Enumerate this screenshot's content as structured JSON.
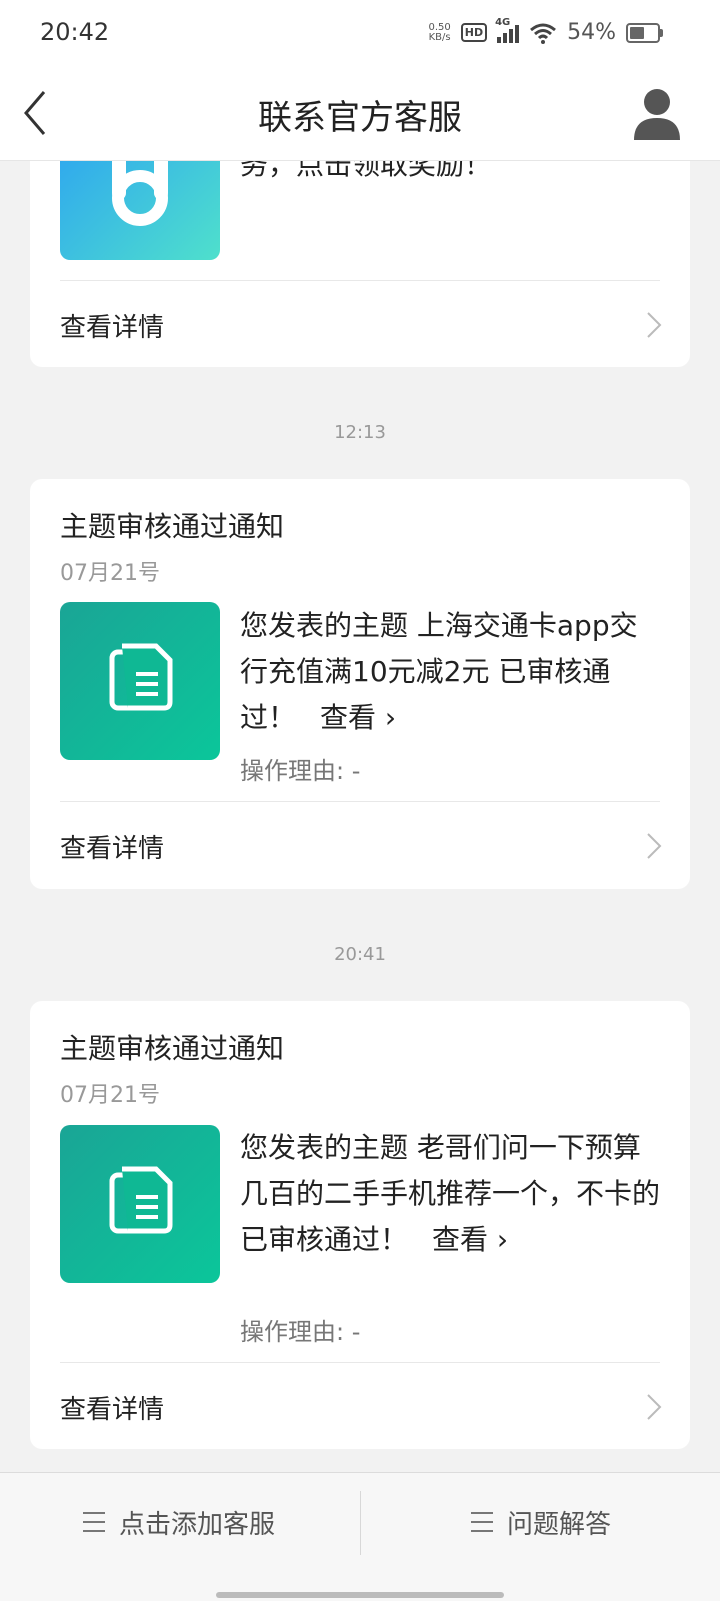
{
  "status": {
    "time": "20:42",
    "net_speed_value": "0.50",
    "net_speed_unit": "KB/s",
    "hd": "HD",
    "network": "4G",
    "battery": "54%",
    "battery_level": 0.54
  },
  "header": {
    "title": "联系官方客服"
  },
  "cards": [
    {
      "message_tail": "务，点击领取奖励！",
      "detail_label": "查看详情"
    },
    {
      "timestamp": "12:13",
      "title": "主题审核通过通知",
      "date": "07月21号",
      "message": "您发表的主题 上海交通卡app交行充值满10元减2元 已审核通过！",
      "view": "查看 ›",
      "reason": "操作理由: -",
      "detail_label": "查看详情"
    },
    {
      "timestamp": "20:41",
      "title": "主题审核通过通知",
      "date": "07月21号",
      "message": "您发表的主题 老哥们问一下预算几百的二手手机推荐一个，不卡的 已审核通过！",
      "view": "查看 ›",
      "reason": "操作理由: -",
      "detail_label": "查看详情"
    }
  ],
  "bottom": {
    "add_service": "点击添加客服",
    "faq": "问题解答"
  },
  "colors": {
    "thumb_green": "#0bc69a",
    "thumb_blue": "#2ba0f3",
    "background": "#f2f2f2"
  }
}
